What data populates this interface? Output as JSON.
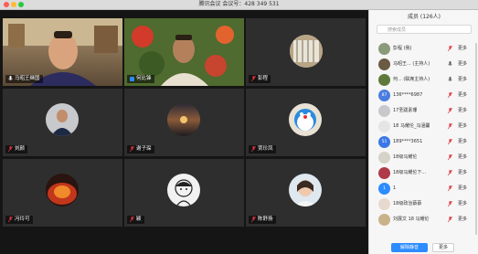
{
  "window": {
    "title": "腾讯会议",
    "meeting_label": "会议号：",
    "meeting_id": "428 349 531",
    "controls": [
      "close",
      "minimize",
      "zoom"
    ]
  },
  "gallery": {
    "tiles": [
      {
        "name": "马昭王继国",
        "mic": "unmuted",
        "kind": "video"
      },
      {
        "name": "何比锋",
        "mic": "unmuted",
        "kind": "video",
        "speaking": true
      },
      {
        "name": "彭程",
        "mic": "muted",
        "kind": "avatar"
      },
      {
        "name": "刘颜",
        "mic": "muted",
        "kind": "avatar"
      },
      {
        "name": "谢子琛",
        "mic": "muted",
        "kind": "avatar"
      },
      {
        "name": "贾珍凤",
        "mic": "muted",
        "kind": "avatar"
      },
      {
        "name": "冯玲可",
        "mic": "muted",
        "kind": "avatar"
      },
      {
        "name": "颖",
        "mic": "muted",
        "kind": "avatar"
      },
      {
        "name": "陈舒扬",
        "mic": "muted",
        "kind": "avatar"
      }
    ]
  },
  "participants": {
    "header": "成员 (126人)",
    "search_placeholder": "搜索成员",
    "items": [
      {
        "name": "彭程 (我)",
        "avatar_kind": "photo",
        "mic": "muted",
        "more": "更多"
      },
      {
        "name": "马昭王... (主持人)",
        "avatar_kind": "photo",
        "mic": "unmuted",
        "more": "更多"
      },
      {
        "name": "何... (联席主持人)",
        "avatar_kind": "photo",
        "mic": "unmuted",
        "more": "更多"
      },
      {
        "name": "136****6987",
        "avatar_kind": "initials",
        "initials": "87",
        "color": "#4a7de0",
        "mic": "muted",
        "more": "更多"
      },
      {
        "name": "17圣跋素珊",
        "avatar_kind": "photo",
        "mic": "muted",
        "more": "更多"
      },
      {
        "name": "18 马耀伦_冯涵馨",
        "avatar_kind": "photo",
        "mic": "muted",
        "more": "更多"
      },
      {
        "name": "189****3651",
        "avatar_kind": "initials",
        "initials": "51",
        "color": "#3b78e7",
        "mic": "muted",
        "more": "更多"
      },
      {
        "name": "18级马耀伦",
        "avatar_kind": "photo",
        "mic": "muted",
        "more": "更多"
      },
      {
        "name": "18级马耀伦下...",
        "avatar_kind": "photo",
        "mic": "muted",
        "more": "更多"
      },
      {
        "name": "1",
        "avatar_kind": "initials",
        "initials": "1",
        "color": "#2d8cff",
        "mic": "muted",
        "more": "更多"
      },
      {
        "name": "18级政治蔡蔡",
        "avatar_kind": "photo",
        "mic": "muted",
        "more": "更多"
      },
      {
        "name": "刘展文 18 马耀伦",
        "avatar_kind": "photo",
        "mic": "muted",
        "more": "更多"
      }
    ],
    "buttons": {
      "mute_all": "解除静音",
      "more": "更多"
    }
  },
  "colors": {
    "accent": "#2d8cff",
    "speaking": "#7fd64a",
    "muted_mic": "#e0333a"
  }
}
